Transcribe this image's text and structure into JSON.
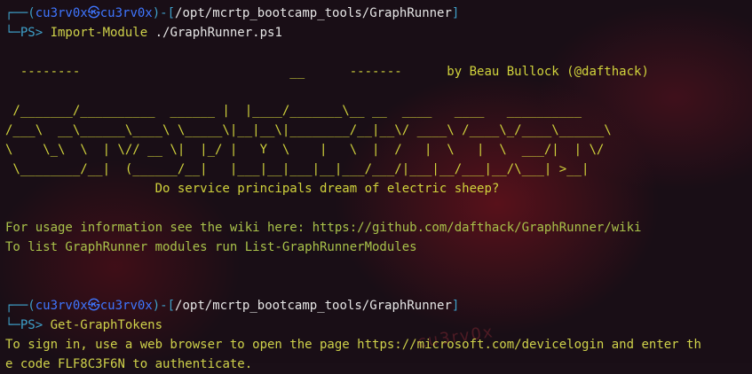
{
  "background": {
    "watermark_text": "cu3rv0x"
  },
  "prompt1": {
    "open": "┌──(",
    "user": "cu3rv0x",
    "at": "㉿",
    "host": "cu3rv0x",
    "close": ")-[",
    "path": "/opt/mcrtp_bootcamp_tools/GraphRunner",
    "end": "]",
    "ps": "└─PS> ",
    "cmd_name": "Import-Module",
    "cmd_arg": " ./GraphRunner.ps1"
  },
  "banner": {
    "line1": "  --------                            __      -------",
    "author": "      by Beau Bullock (@dafthack)",
    "line2": " /_______/__________  ______ |  |____/_______\\__ __  ____   ____   __________",
    "line3": "/___\\  __\\______\\____\\ \\_____\\|__|__\\|________/__|__\\/ ____\\ /____\\_/____\\______\\",
    "line4": "\\    \\_\\  \\  | \\// __ \\|  |_/ |   Y  \\    |   \\  |  /   |  \\   |  \\  ___/|  | \\/",
    "line5": " \\________/__|  (______/__|   |___|__|___|__|___/___/|___|__/___|__/\\___| >__|",
    "tagline": "                    Do service principals dream of electric sheep?"
  },
  "info": {
    "usage": "For usage information see the wiki here: https://github.com/dafthack/GraphRunner/wiki",
    "modules": "To list GraphRunner modules run List-GraphRunnerModules"
  },
  "prompt2": {
    "open": "┌──(",
    "user": "cu3rv0x",
    "at": "㉿",
    "host": "cu3rv0x",
    "close": ")-[",
    "path": "/opt/mcrtp_bootcamp_tools/GraphRunner",
    "end": "]",
    "ps": "└─PS> ",
    "cmd_name": "Get-GraphTokens"
  },
  "output": {
    "line1_a": "To sign in, use a web browser to open the page ",
    "line1_url": "https://microsoft.com/devicelogin",
    "line1_b": " and enter th",
    "line2_a": "e code ",
    "line2_code": "FLF8C3F6N",
    "line2_b": " to authenticate."
  }
}
